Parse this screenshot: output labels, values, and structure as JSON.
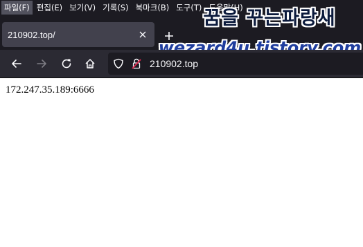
{
  "menu": {
    "items": [
      {
        "label": "파일(F)"
      },
      {
        "label": "편집(E)"
      },
      {
        "label": "보기(V)"
      },
      {
        "label": "기록(S)"
      },
      {
        "label": "북마크(B)"
      },
      {
        "label": "도구(T)"
      },
      {
        "label": "도움말(H)"
      }
    ]
  },
  "tab": {
    "title": "210902.top/",
    "close_icon": "close-icon"
  },
  "new_tab_icon": "plus-icon",
  "watermark": {
    "line1": "꿈을 꾸는파랑새",
    "line2": "wezard4u.tistory.com"
  },
  "nav": {
    "back_icon": "arrow-left-icon",
    "forward_icon": "arrow-right-icon",
    "reload_icon": "reload-icon",
    "home_icon": "home-icon"
  },
  "urlbar": {
    "url": "210902.top",
    "shield_icon": "shield-icon",
    "lock_icon": "insecure-lock-icon"
  },
  "page": {
    "text": "172.247.35.189:6666"
  },
  "colors": {
    "chrome_dark": "#1c1b22",
    "tab_bg": "#42414d",
    "toolbar_bg": "#2b2a33",
    "text_light": "#fbfbfe",
    "insecure_red": "#e22850",
    "watermark_navy": "#0b1a3c",
    "watermark_blue": "#1f3d9e"
  }
}
